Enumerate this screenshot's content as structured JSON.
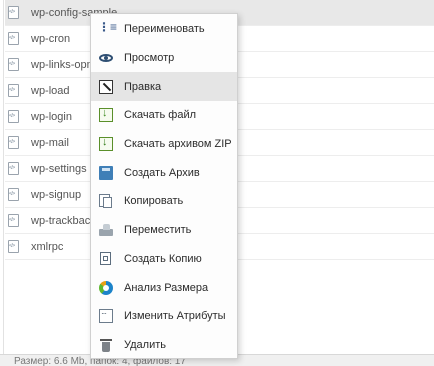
{
  "files": [
    {
      "name": "wp-config-sample"
    },
    {
      "name": "wp-cron"
    },
    {
      "name": "wp-links-opml"
    },
    {
      "name": "wp-load"
    },
    {
      "name": "wp-login"
    },
    {
      "name": "wp-mail"
    },
    {
      "name": "wp-settings"
    },
    {
      "name": "wp-signup"
    },
    {
      "name": "wp-trackback"
    },
    {
      "name": "xmlrpc"
    }
  ],
  "status_bar": {
    "text": "Размер: 6.6 Mb, папок: 4, файлов: 17"
  },
  "context_menu": {
    "items": [
      {
        "label": "Переименовать",
        "icon": "rename-icon"
      },
      {
        "label": "Просмотр",
        "icon": "eye-icon"
      },
      {
        "label": "Правка",
        "icon": "edit-icon"
      },
      {
        "label": "Скачать файл",
        "icon": "download-icon"
      },
      {
        "label": "Скачать архивом ZIP",
        "icon": "download-zip-icon"
      },
      {
        "label": "Создать Архив",
        "icon": "archive-icon"
      },
      {
        "label": "Копировать",
        "icon": "copy-icon"
      },
      {
        "label": "Переместить",
        "icon": "move-icon"
      },
      {
        "label": "Создать Копию",
        "icon": "duplicate-icon"
      },
      {
        "label": "Анализ Размера",
        "icon": "size-analysis-icon"
      },
      {
        "label": "Изменить Атрибуты",
        "icon": "attributes-icon"
      },
      {
        "label": "Удалить",
        "icon": "trash-icon"
      }
    ],
    "highlighted_index": 2
  }
}
